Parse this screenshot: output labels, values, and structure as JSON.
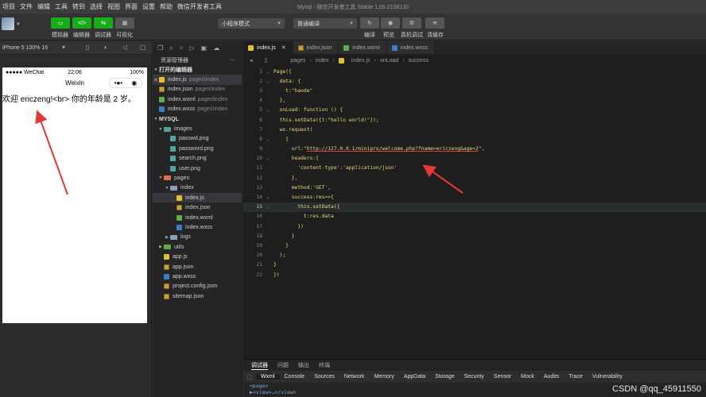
{
  "menubar": {
    "items": [
      "项目",
      "文件",
      "编辑",
      "工具",
      "转到",
      "选择",
      "视图",
      "界面",
      "设置",
      "帮助",
      "微信开发者工具"
    ],
    "window_title": "Mysql - 微信开发者工具 Stable 1.05.2108130"
  },
  "toolbar": {
    "simulator": "模拟器",
    "editor": "编辑器",
    "debugger": "调试器",
    "visual": "可视化",
    "mode_select": "小程序模式",
    "compile_select": "普通编译",
    "compile": "编译",
    "preview": "预览",
    "remote_debug": "真机调试",
    "clear_cache": "清缓存"
  },
  "simulator": {
    "device": "iPhone 5 100% 16",
    "carrier": "●●●●● WeChat",
    "time": "22:06",
    "battery": "100%",
    "nav_title": "Weixin",
    "page_text": "欢迎 ericzeng!<br> 你的年龄是 2 岁。"
  },
  "explorer": {
    "title": "资源管理器",
    "open_editors": "打开的编辑器",
    "open_files": [
      {
        "name": "index.js",
        "path": "pages\\index",
        "icon": "js"
      },
      {
        "name": "index.json",
        "path": "pages\\index",
        "icon": "json"
      },
      {
        "name": "index.wxml",
        "path": "pages\\index",
        "icon": "wxml"
      },
      {
        "name": "index.wxss",
        "path": "pages\\index",
        "icon": "wxss"
      }
    ],
    "project": "MYSQL",
    "images_folder": "images",
    "images": [
      "passwd.png",
      "password.png",
      "search.png",
      "user.png"
    ],
    "pages_folder": "pages",
    "index_folder": "index",
    "index_files": [
      {
        "name": "index.js",
        "icon": "js"
      },
      {
        "name": "index.json",
        "icon": "json"
      },
      {
        "name": "index.wxml",
        "icon": "wxml"
      },
      {
        "name": "index.wxss",
        "icon": "wxss"
      }
    ],
    "logs_folder": "logs",
    "utils_folder": "utils",
    "root_files": [
      {
        "name": "app.js",
        "icon": "js"
      },
      {
        "name": "app.json",
        "icon": "json"
      },
      {
        "name": "app.wxss",
        "icon": "wxss"
      },
      {
        "name": "project.config.json",
        "icon": "json"
      },
      {
        "name": "sitemap.json",
        "icon": "json"
      }
    ]
  },
  "editor": {
    "tabs": [
      "index.js",
      "index.json",
      "index.wxml",
      "index.wxss"
    ],
    "breadcrumb": [
      "pages",
      "index",
      "index.js",
      "onLoad",
      "success"
    ],
    "lines": [
      {
        "n": "1",
        "text": "Page({"
      },
      {
        "n": "2",
        "text": "  data: {"
      },
      {
        "n": "3",
        "text": "    t:\"haode\""
      },
      {
        "n": "4",
        "text": "  },"
      },
      {
        "n": "5",
        "text": "  onLoad: function () {"
      },
      {
        "n": "6",
        "text": "  this.setData({t:\"hello world!\"});"
      },
      {
        "n": "7",
        "text": "  wx.request("
      },
      {
        "n": "8",
        "text": "    {"
      },
      {
        "n": "9",
        "text": "      url:\"http://127.0.0.1/minipro/welcome.php?fname=ericzeng&age=2\","
      },
      {
        "n": "10",
        "text": "      headers:{"
      },
      {
        "n": "11",
        "text": "        'content-type':'application/json'"
      },
      {
        "n": "12",
        "text": "      },"
      },
      {
        "n": "13",
        "text": "      method:'GET',"
      },
      {
        "n": "14",
        "text": "      success:res=>{"
      },
      {
        "n": "15",
        "text": "        this.setData({"
      },
      {
        "n": "16",
        "text": "          t:res.data"
      },
      {
        "n": "17",
        "text": "        })"
      },
      {
        "n": "18",
        "text": "      }"
      },
      {
        "n": "19",
        "text": "    }"
      },
      {
        "n": "20",
        "text": "  );"
      },
      {
        "n": "21",
        "text": "}"
      },
      {
        "n": "22",
        "text": "})"
      }
    ]
  },
  "devtools": {
    "tabs": [
      "调试器",
      "问题",
      "输出",
      "终端"
    ],
    "panels": [
      "Wxml",
      "Console",
      "Sources",
      "Network",
      "Memory",
      "AppData",
      "Storage",
      "Security",
      "Sensor",
      "Mock",
      "Audits",
      "Trace",
      "Vulnerability"
    ],
    "body_line1": "<page>",
    "body_line2": "▶<view>…</view>"
  },
  "watermark": "CSDN @qq_45911550",
  "colors": {
    "accent_green": "#1aad19",
    "annotation_red": "#e53935"
  }
}
